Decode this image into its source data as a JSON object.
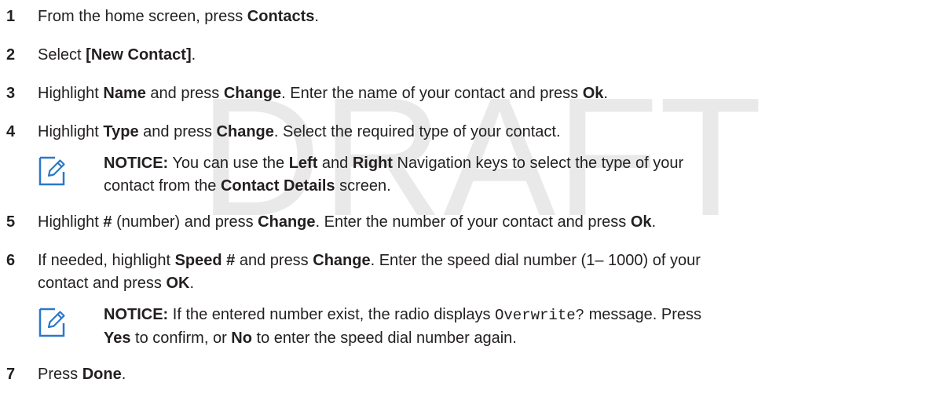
{
  "watermark": "DRAFT",
  "steps": [
    {
      "number": "1",
      "parts": [
        "From the home screen, press ",
        "Contacts",
        "."
      ]
    },
    {
      "number": "2",
      "parts": [
        "Select ",
        "[New Contact]",
        "."
      ]
    },
    {
      "number": "3",
      "parts": [
        "Highlight ",
        "Name",
        " and press ",
        "Change",
        ". Enter the name of your contact and press ",
        "Ok",
        "."
      ]
    },
    {
      "number": "4",
      "parts": [
        "Highlight ",
        "Type",
        " and press ",
        "Change",
        ". Select the required type of your contact."
      ]
    },
    {
      "number": "5",
      "parts": [
        "Highlight ",
        "#",
        " (number) and press ",
        "Change",
        ". Enter the number of your contact and press ",
        "Ok",
        "."
      ]
    },
    {
      "number": "6",
      "parts": [
        "If needed, highlight ",
        "Speed #",
        " and press ",
        "Change",
        ". Enter the speed dial number (1– 1000) of your",
        "contact and press ",
        "OK",
        "."
      ]
    },
    {
      "number": "7",
      "parts": [
        "Press ",
        "Done",
        "."
      ]
    }
  ],
  "notices": [
    {
      "icon": "pencil-note-icon",
      "label": "NOTICE:",
      "parts": [
        " You can use the ",
        "Left",
        " and ",
        "Right",
        " Navigation keys to select the type of your",
        "contact from the ",
        "Contact Details",
        " screen."
      ]
    },
    {
      "icon": "pencil-note-icon",
      "label": "NOTICE:",
      "parts": [
        " If the entered number exist, the radio displays ",
        "Overwrite?",
        " message. Press",
        "Yes",
        " to confirm, or ",
        "No",
        " to enter the speed dial number again."
      ]
    }
  ]
}
